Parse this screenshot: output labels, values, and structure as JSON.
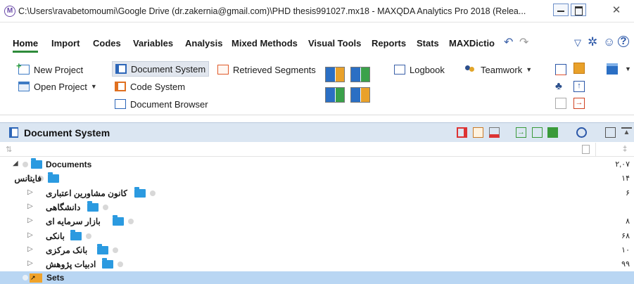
{
  "window": {
    "title": "C:\\Users\\ravabetomoumi\\Google Drive (dr.zakernia@gmail.com)\\PHD thesis991027.mx18 - MAXQDA Analytics Pro 2018 (Relea...",
    "app_icon": "M"
  },
  "menu": {
    "tabs": [
      "Home",
      "Import",
      "Codes",
      "Variables",
      "Analysis",
      "Mixed Methods",
      "Visual Tools",
      "Reports",
      "Stats",
      "MAXDictio"
    ],
    "active": "Home"
  },
  "ribbon": {
    "new_project": "New Project",
    "open_project": "Open Project",
    "document_system": "Document System",
    "retrieved_segments": "Retrieved Segments",
    "code_system": "Code System",
    "document_browser": "Document Browser",
    "logbook": "Logbook",
    "teamwork": "Teamwork"
  },
  "panel": {
    "title": "Document System"
  },
  "tree": {
    "root": {
      "label": "Documents",
      "count": "۲,۰۷"
    },
    "children": [
      {
        "label": "فاینانس",
        "count": "۱۴"
      },
      {
        "label": "کانون مشاورین اعتباری",
        "count": "۶"
      },
      {
        "label": "دانشگاهی",
        "count": ""
      },
      {
        "label": "بازار سرمایه ای",
        "count": "۸"
      },
      {
        "label": "بانکی",
        "count": "۶۸"
      },
      {
        "label": "بانک مرکزی",
        "count": "۱۰"
      },
      {
        "label": "ادبیات پژوهش",
        "count": "۹۹"
      }
    ],
    "sets": {
      "label": "Sets"
    }
  },
  "colors": {
    "accent_green": "#2e8b3a",
    "panel_header": "#dbe6f2",
    "folder_blue": "#2b9ae0",
    "selection": "#b9d6f3",
    "sets_orange": "#f0a32a"
  }
}
